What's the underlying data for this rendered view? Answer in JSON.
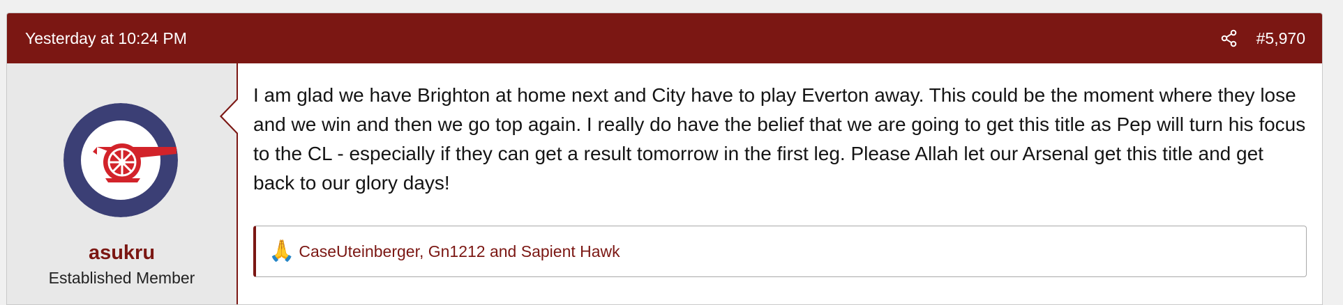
{
  "post": {
    "timestamp": "Yesterday at 10:24 PM",
    "share_icon": "share-icon",
    "number": "#5,970",
    "header_color": "#7b1713"
  },
  "user": {
    "avatar_icon": "arsenal-cannon-logo",
    "name": "asukru",
    "title": "Established Member"
  },
  "message": {
    "body": "I am glad we have Brighton at home next and City have to play Everton away. This could be the moment where they lose and we win and then we go top again. I really do have the belief that we are going to get this title as Pep will turn his focus to the CL - especially if they can get a result tomorrow in the first leg. Please Allah let our Arsenal get this title and get back to our glory days!"
  },
  "reactions": {
    "icon": "🙏",
    "users": "CaseUteinberger, Gn1212 and Sapient Hawk"
  }
}
